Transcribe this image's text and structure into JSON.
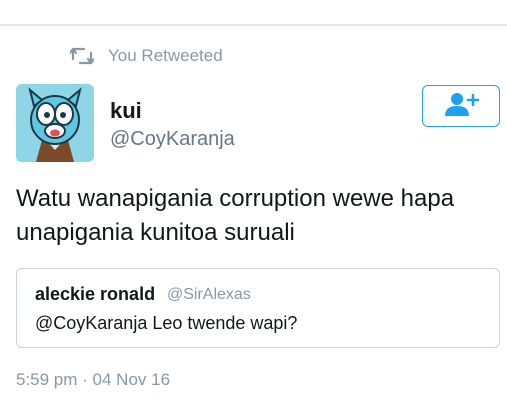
{
  "retweet": {
    "icon": "retweet-icon",
    "label": "You Retweeted"
  },
  "author": {
    "name": "kui",
    "handle": "@CoyKaranja",
    "avatar": "gumball-avatar"
  },
  "follow_button": {
    "icon": "follow-user-icon",
    "color": "#1da1f2"
  },
  "tweet": {
    "text": "Watu wanapigania corruption wewe hapa unapigania kunitoa suruali"
  },
  "quoted_tweet": {
    "name": "aleckie ronald",
    "handle": "@SirAlexas",
    "text": "@CoyKaranja Leo twende wapi?"
  },
  "timestamp": "5:59 pm · 04 Nov 16",
  "colors": {
    "accent": "#1da1f2",
    "muted": "#8899a6",
    "text": "#14171a",
    "avatar_bg": "#8ed5e5"
  }
}
